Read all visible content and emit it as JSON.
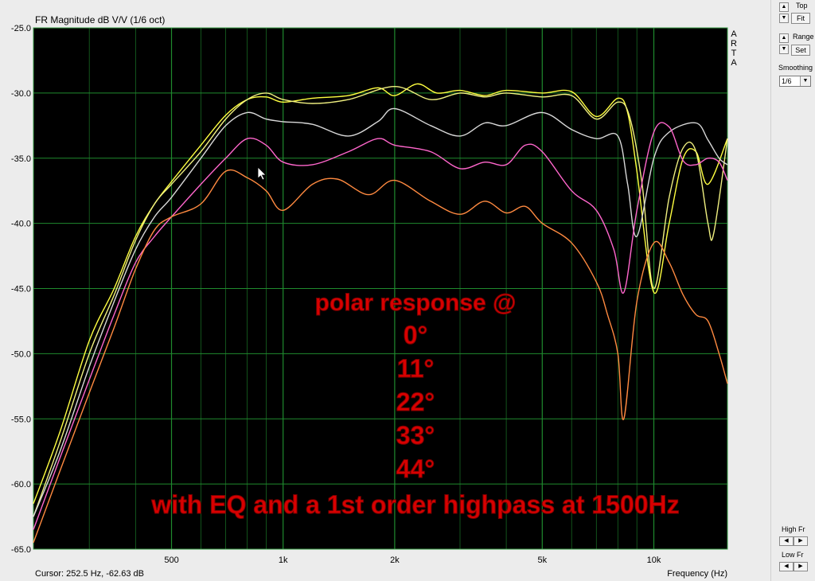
{
  "chart_data": {
    "type": "line",
    "title": "FR Magnitude dB V/V (1/6 oct)",
    "xlabel": "Frequency (Hz)",
    "x_scale": "log",
    "xlim": [
      212,
      15800
    ],
    "ylim": [
      -65,
      -25
    ],
    "grid": true,
    "y_ticks": [
      -25,
      -30,
      -35,
      -40,
      -45,
      -50,
      -55,
      -60,
      -65
    ],
    "y_tick_labels": [
      "-25.0",
      "-30.0",
      "-35.0",
      "-40.0",
      "-45.0",
      "-50.0",
      "-55.0",
      "-60.0",
      "-65.0"
    ],
    "x_ticks": [
      500,
      1000,
      2000,
      5000,
      10000
    ],
    "x_tick_labels": [
      "500",
      "1k",
      "2k",
      "5k",
      "10k"
    ],
    "background": "#000000",
    "grid_color": "#1f8a2e",
    "series": [
      {
        "color": "#ffff40",
        "points": [
          [
            212,
            -61.5
          ],
          [
            250,
            -56
          ],
          [
            300,
            -49
          ],
          [
            350,
            -45
          ],
          [
            400,
            -41
          ],
          [
            450,
            -38.5
          ],
          [
            500,
            -36.8
          ],
          [
            600,
            -34
          ],
          [
            700,
            -31.7
          ],
          [
            800,
            -30.5
          ],
          [
            900,
            -30.3
          ],
          [
            1000,
            -30.7
          ],
          [
            1200,
            -30.4
          ],
          [
            1500,
            -30.2
          ],
          [
            1800,
            -29.6
          ],
          [
            2000,
            -30.2
          ],
          [
            2300,
            -29.3
          ],
          [
            2600,
            -30.0
          ],
          [
            3000,
            -29.8
          ],
          [
            3500,
            -30.2
          ],
          [
            4000,
            -29.8
          ],
          [
            5000,
            -30.0
          ],
          [
            6000,
            -29.9
          ],
          [
            7000,
            -31.8
          ],
          [
            8000,
            -30.4
          ],
          [
            8500,
            -31.5
          ],
          [
            9000,
            -36
          ],
          [
            10000,
            -45.3
          ],
          [
            11000,
            -40
          ],
          [
            12000,
            -35
          ],
          [
            13000,
            -34.5
          ],
          [
            14000,
            -37
          ],
          [
            15800,
            -33.5
          ]
        ]
      },
      {
        "color": "#f0f080",
        "points": [
          [
            212,
            -62.5
          ],
          [
            250,
            -56.8
          ],
          [
            300,
            -50
          ],
          [
            350,
            -45.5
          ],
          [
            400,
            -41.3
          ],
          [
            450,
            -38.5
          ],
          [
            500,
            -37
          ],
          [
            600,
            -34.5
          ],
          [
            700,
            -32
          ],
          [
            800,
            -30.5
          ],
          [
            900,
            -30.0
          ],
          [
            1000,
            -30.5
          ],
          [
            1200,
            -30.8
          ],
          [
            1500,
            -30.5
          ],
          [
            2000,
            -29.5
          ],
          [
            2500,
            -30.5
          ],
          [
            3000,
            -30.0
          ],
          [
            3500,
            -30.3
          ],
          [
            4000,
            -30.0
          ],
          [
            5000,
            -30.3
          ],
          [
            6000,
            -30.2
          ],
          [
            7000,
            -32
          ],
          [
            8000,
            -30.7
          ],
          [
            8600,
            -31.8
          ],
          [
            9300,
            -37
          ],
          [
            10000,
            -45.0
          ],
          [
            11000,
            -38
          ],
          [
            12000,
            -34.2
          ],
          [
            13000,
            -34.5
          ],
          [
            14000,
            -40
          ],
          [
            14500,
            -40.8
          ],
          [
            15800,
            -33.5
          ]
        ]
      },
      {
        "color": "#d8d8d8",
        "points": [
          [
            212,
            -62.5
          ],
          [
            250,
            -57.5
          ],
          [
            300,
            -51
          ],
          [
            350,
            -46
          ],
          [
            400,
            -42
          ],
          [
            450,
            -39.5
          ],
          [
            500,
            -38
          ],
          [
            600,
            -35
          ],
          [
            700,
            -32.5
          ],
          [
            800,
            -31.5
          ],
          [
            900,
            -32
          ],
          [
            1000,
            -32.2
          ],
          [
            1200,
            -32.4
          ],
          [
            1500,
            -33.3
          ],
          [
            1800,
            -32.2
          ],
          [
            2000,
            -31.2
          ],
          [
            2500,
            -32.5
          ],
          [
            3000,
            -33.3
          ],
          [
            3500,
            -32.3
          ],
          [
            4000,
            -32.5
          ],
          [
            5000,
            -31.5
          ],
          [
            6000,
            -32.8
          ],
          [
            7000,
            -33.5
          ],
          [
            8000,
            -33.3
          ],
          [
            8500,
            -37
          ],
          [
            9000,
            -41
          ],
          [
            10000,
            -35
          ],
          [
            11000,
            -33.0
          ],
          [
            13000,
            -32.3
          ],
          [
            14000,
            -33.6
          ],
          [
            15000,
            -35
          ],
          [
            15800,
            -35.5
          ]
        ]
      },
      {
        "color": "#ff66cc",
        "points": [
          [
            212,
            -63.5
          ],
          [
            250,
            -58
          ],
          [
            300,
            -52
          ],
          [
            350,
            -47
          ],
          [
            400,
            -43
          ],
          [
            450,
            -41
          ],
          [
            500,
            -39.5
          ],
          [
            600,
            -37
          ],
          [
            700,
            -35
          ],
          [
            800,
            -33.5
          ],
          [
            900,
            -34
          ],
          [
            1000,
            -35.3
          ],
          [
            1200,
            -35.5
          ],
          [
            1500,
            -34.5
          ],
          [
            1800,
            -33.5
          ],
          [
            2000,
            -34
          ],
          [
            2500,
            -34.5
          ],
          [
            3000,
            -35.8
          ],
          [
            3500,
            -35.3
          ],
          [
            4000,
            -35.5
          ],
          [
            4500,
            -34
          ],
          [
            5000,
            -34.5
          ],
          [
            6000,
            -37.5
          ],
          [
            7000,
            -39
          ],
          [
            7800,
            -42
          ],
          [
            8300,
            -45.3
          ],
          [
            9000,
            -39
          ],
          [
            10000,
            -33
          ],
          [
            11000,
            -32.6
          ],
          [
            12000,
            -35.2
          ],
          [
            13000,
            -35.5
          ],
          [
            14000,
            -35
          ],
          [
            15000,
            -35.3
          ],
          [
            15800,
            -36.7
          ]
        ]
      },
      {
        "color": "#ff8a40",
        "points": [
          [
            212,
            -64.5
          ],
          [
            250,
            -59
          ],
          [
            300,
            -53
          ],
          [
            350,
            -48
          ],
          [
            400,
            -43.5
          ],
          [
            450,
            -40.5
          ],
          [
            500,
            -39.5
          ],
          [
            600,
            -38.5
          ],
          [
            700,
            -36
          ],
          [
            800,
            -36.5
          ],
          [
            900,
            -37.5
          ],
          [
            1000,
            -39
          ],
          [
            1200,
            -37
          ],
          [
            1400,
            -36.6
          ],
          [
            1700,
            -37.8
          ],
          [
            2000,
            -36.7
          ],
          [
            2500,
            -38.3
          ],
          [
            3000,
            -39.3
          ],
          [
            3500,
            -38.3
          ],
          [
            4000,
            -39.2
          ],
          [
            4500,
            -38.7
          ],
          [
            5000,
            -40
          ],
          [
            6000,
            -41.5
          ],
          [
            7000,
            -44.5
          ],
          [
            7500,
            -47
          ],
          [
            8000,
            -50
          ],
          [
            8300,
            -55
          ],
          [
            9000,
            -46
          ],
          [
            10000,
            -41.5
          ],
          [
            11000,
            -43
          ],
          [
            12000,
            -45.5
          ],
          [
            13000,
            -47
          ],
          [
            14000,
            -47.5
          ],
          [
            15000,
            -50
          ],
          [
            15800,
            -52.3
          ]
        ]
      }
    ]
  },
  "overlay": {
    "lines": [
      "polar response @",
      "0°",
      "11°",
      "22°",
      "33°",
      "44°",
      "with EQ and a 1st order highpass at 1500Hz"
    ],
    "color": "#d80000"
  },
  "legend_letters": [
    "A",
    "R",
    "T",
    "A"
  ],
  "cursor_readout": "Cursor: 252.5 Hz, -62.63 dB",
  "panel": {
    "top_label": "Top",
    "fit_button": "Fit",
    "range_label": "Range",
    "set_button": "Set",
    "smoothing_label": "Smoothing",
    "smoothing_value": "1/6",
    "high_fr_label": "High Fr",
    "low_fr_label": "Low Fr"
  }
}
